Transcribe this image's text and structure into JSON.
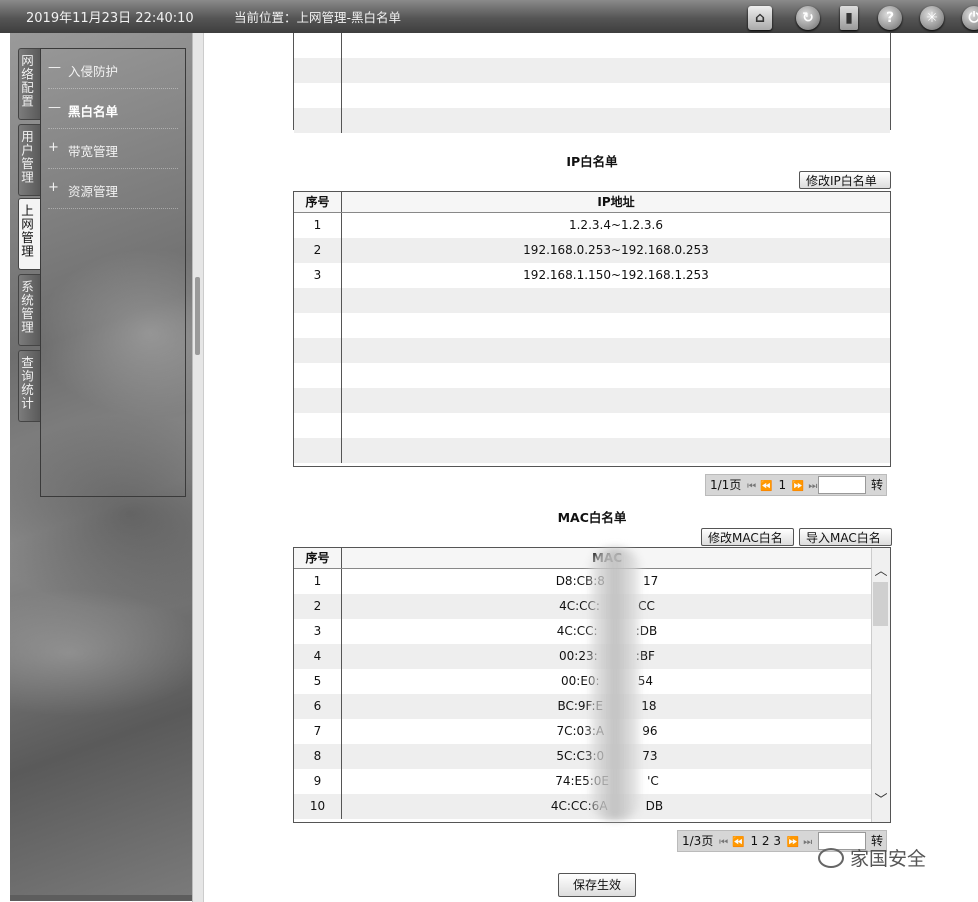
{
  "topbar": {
    "datetime": "2019年11月23日 22:40:10",
    "location": "当前位置：上网管理-黑白名单",
    "icons": [
      "home-icon",
      "refresh-icon",
      "logout-icon",
      "help-icon",
      "settings-icon",
      "power-icon"
    ]
  },
  "sidebar": {
    "tabs": [
      {
        "label": "网络配置"
      },
      {
        "label": "用户管理"
      },
      {
        "label": "上网管理",
        "active": true
      },
      {
        "label": "系统管理"
      },
      {
        "label": "查询统计"
      }
    ],
    "items": [
      {
        "marker": "—",
        "label": "入侵防护"
      },
      {
        "marker": "—",
        "label": "黑白名单",
        "active": true
      },
      {
        "marker": "+",
        "label": "带宽管理"
      },
      {
        "marker": "+",
        "label": "资源管理"
      }
    ]
  },
  "ip_whitelist": {
    "title": "IP白名单",
    "edit_button": "修改IP白名单",
    "col_index": "序号",
    "col_addr": "IP地址",
    "rows": [
      {
        "index": "1",
        "addr": "1.2.3.4~1.2.3.6"
      },
      {
        "index": "2",
        "addr": "192.168.0.253~192.168.0.253"
      },
      {
        "index": "3",
        "addr": "192.168.1.150~192.168.1.253"
      }
    ],
    "pager": {
      "page_info": "1/1页",
      "pages": [
        "1"
      ],
      "go": "转",
      "jump_value": ""
    }
  },
  "mac_whitelist": {
    "title": "MAC白名单",
    "edit_button": "修改MAC白名单",
    "import_button": "导入MAC白名单",
    "col_index": "序号",
    "col_addr": "MAC",
    "rows": [
      {
        "index": "1",
        "addr": "D8:CB:8          17"
      },
      {
        "index": "2",
        "addr": "4C:CC:          CC"
      },
      {
        "index": "3",
        "addr": "4C:CC:          :DB"
      },
      {
        "index": "4",
        "addr": "00:23:          :BF"
      },
      {
        "index": "5",
        "addr": "00:E0:          54"
      },
      {
        "index": "6",
        "addr": "BC:9F:E          18"
      },
      {
        "index": "7",
        "addr": "7C:03:A          96"
      },
      {
        "index": "8",
        "addr": "5C:C3:0          73"
      },
      {
        "index": "9",
        "addr": "74:E5:0E          'C"
      },
      {
        "index": "10",
        "addr": "4C:CC:6A          DB"
      }
    ],
    "pager": {
      "page_info": "1/3页",
      "pages": [
        "1",
        "2",
        "3"
      ],
      "go": "转",
      "jump_value": ""
    }
  },
  "save_button": "保存生效",
  "watermark": "家国安全"
}
